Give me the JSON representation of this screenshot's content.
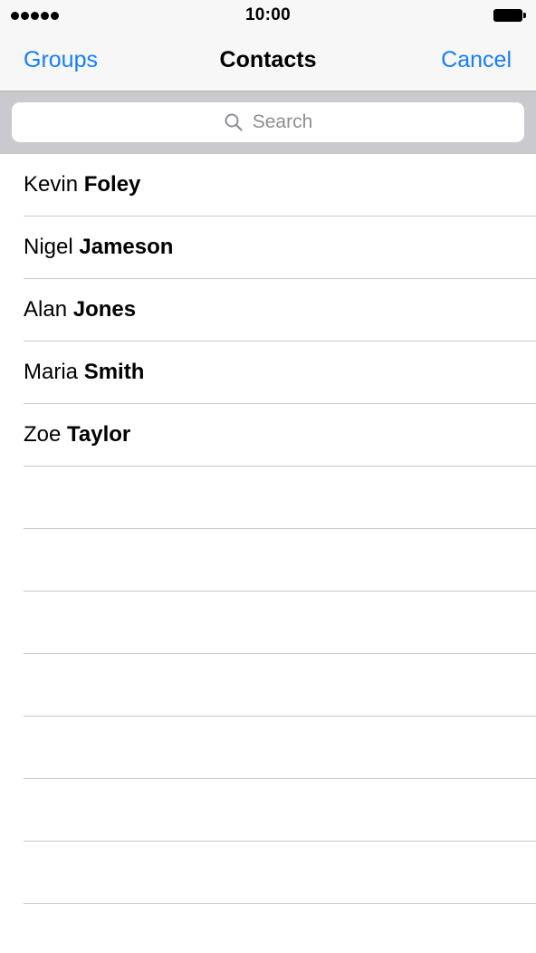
{
  "status_bar": {
    "time": "10:00"
  },
  "nav": {
    "left_label": "Groups",
    "title": "Contacts",
    "right_label": "Cancel",
    "accent_color": "#157efb"
  },
  "search": {
    "placeholder": "Search",
    "icon": "search-icon"
  },
  "contacts": [
    {
      "first": "Kevin",
      "last": "Foley"
    },
    {
      "first": "Nigel",
      "last": "Jameson"
    },
    {
      "first": "Alan",
      "last": "Jones"
    },
    {
      "first": "Maria",
      "last": "Smith"
    },
    {
      "first": "Zoe",
      "last": "Taylor"
    }
  ]
}
